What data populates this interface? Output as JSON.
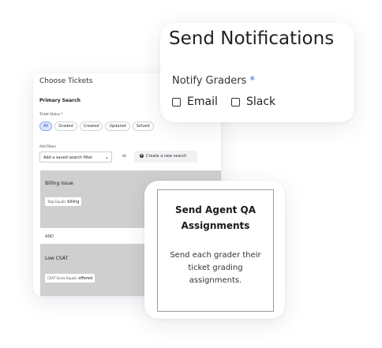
{
  "choose_tickets": {
    "title": "Choose Tickets",
    "section_title": "Primary Search",
    "ticket_status_label": "Ticket Status *",
    "status_chips": [
      "All",
      "Graded",
      "Created",
      "Updated",
      "Solved"
    ],
    "active_chip": "All",
    "add_filters_label": "Add Filters",
    "filter_select_value": "Add a saved search filter",
    "or_label": "or",
    "create_search_label": "Create a new search",
    "conditions": [
      {
        "name": "Billing Issue",
        "field": "Tags Equals",
        "value": "billing"
      },
      {
        "name": "Low CSAT",
        "field": "CSAT Score Equals",
        "value": "offered"
      }
    ],
    "joiner": "AND"
  },
  "notifications": {
    "title": "Send Notifications",
    "label": "Notify Graders",
    "required_mark": "*",
    "options": [
      {
        "label": "Email",
        "checked": false
      },
      {
        "label": "Slack",
        "checked": false
      }
    ]
  },
  "qa": {
    "title_line1": "Send Agent QA",
    "title_line2": "Assignments",
    "description": "Send each grader their ticket grading assignments."
  },
  "colors": {
    "accent": "#2f6cf5",
    "chip_active_bg": "#dbe6ff",
    "condition_bg": "#cfcfcf"
  }
}
